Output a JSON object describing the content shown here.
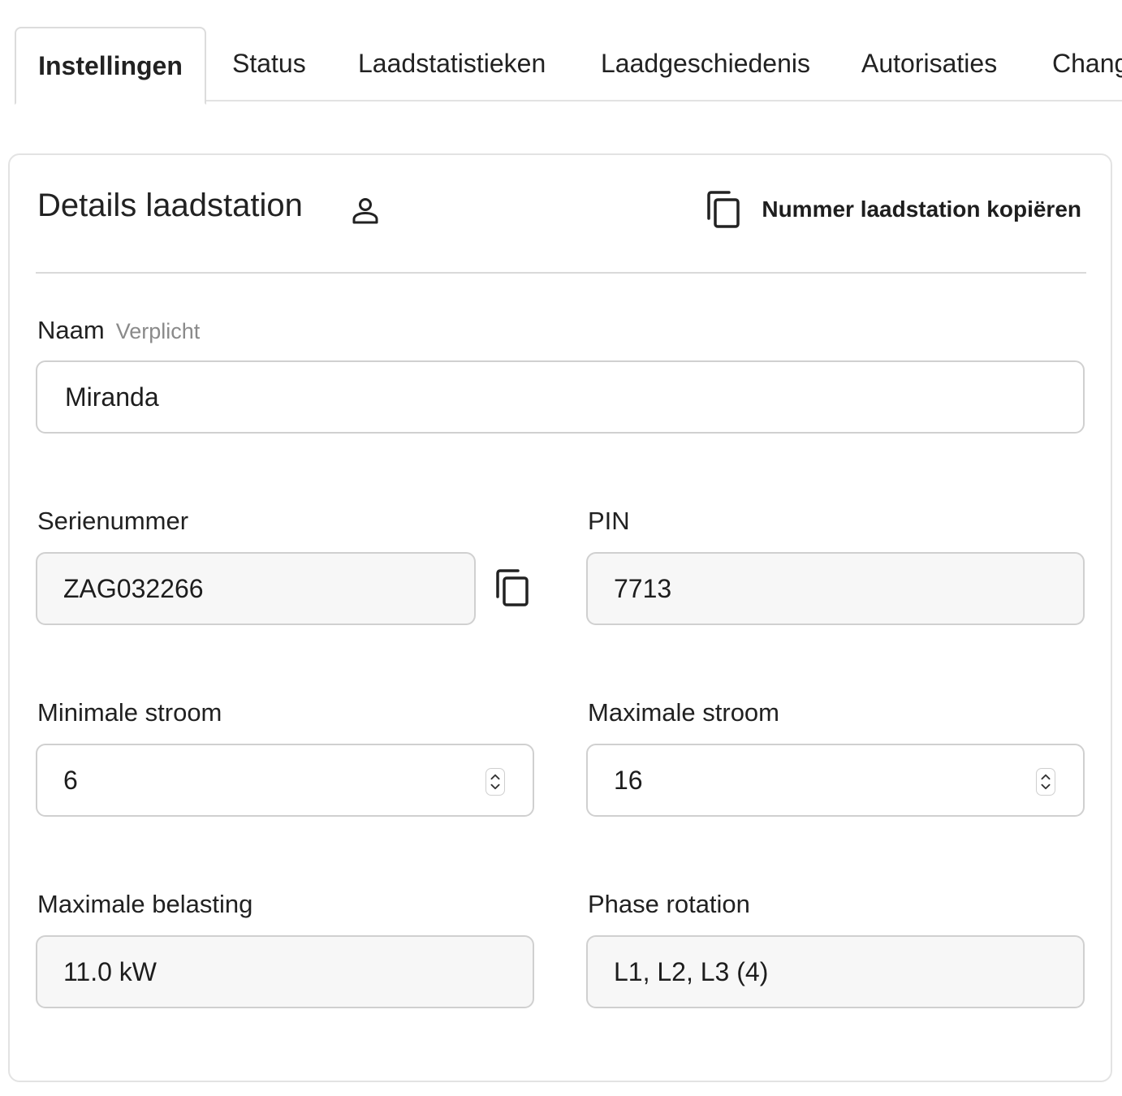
{
  "tabs": [
    {
      "label": "Instellingen",
      "active": true
    },
    {
      "label": "Status"
    },
    {
      "label": "Laadstatistieken"
    },
    {
      "label": "Laadgeschiedenis"
    },
    {
      "label": "Autorisaties"
    },
    {
      "label": "Changelog"
    }
  ],
  "card": {
    "title": "Details laadstation",
    "title_icon": "person-icon",
    "copy_action": {
      "icon": "copy-icon",
      "label": "Nummer laadstation kopiëren"
    }
  },
  "fields": {
    "naam": {
      "label": "Naam",
      "hint": "Verplicht",
      "value": "Miranda"
    },
    "serienummer": {
      "label": "Serienummer",
      "value": "ZAG032266",
      "action_icon": "copy-icon"
    },
    "pin": {
      "label": "PIN",
      "value": "7713"
    },
    "min_stroom": {
      "label": "Minimale stroom",
      "value": "6"
    },
    "max_stroom": {
      "label": "Maximale stroom",
      "value": "16"
    },
    "max_belasting": {
      "label": "Maximale belasting",
      "value": "11.0 kW"
    },
    "phase_rotation": {
      "label": "Phase rotation",
      "value": "L1, L2, L3 (4)"
    }
  }
}
